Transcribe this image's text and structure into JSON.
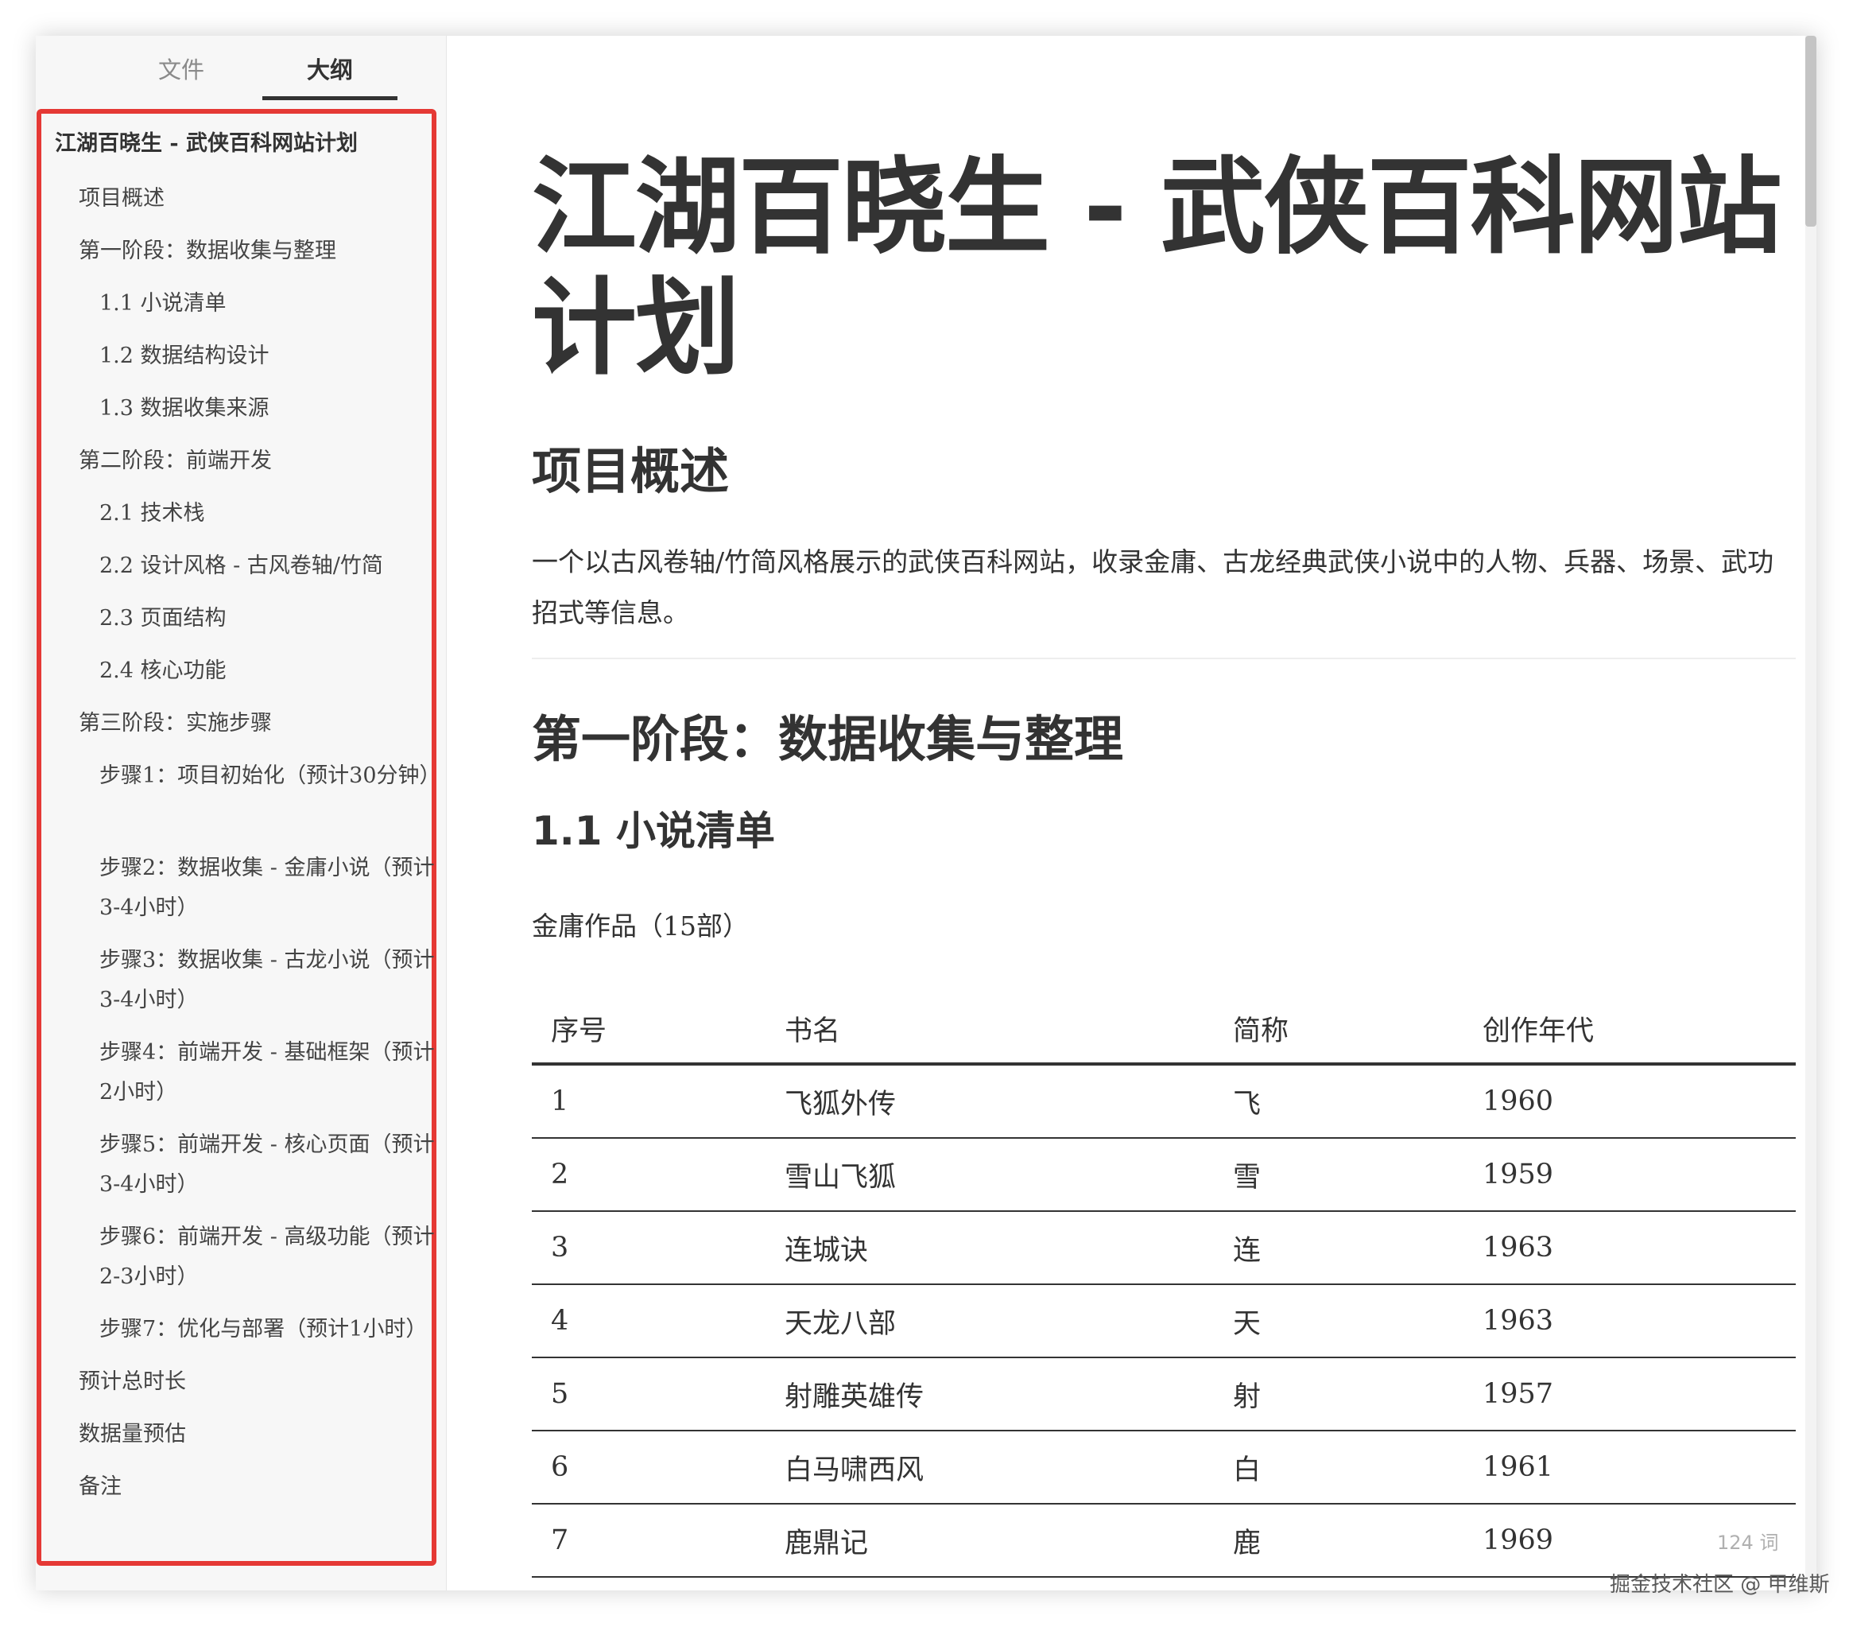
{
  "tabs": {
    "files": "文件",
    "outline": "大纲"
  },
  "outline": [
    {
      "level": "h1",
      "label": "江湖百晓生 - 武侠百科网站计划"
    },
    {
      "level": "h2",
      "label": "项目概述"
    },
    {
      "level": "h2",
      "label": "第一阶段：数据收集与整理"
    },
    {
      "level": "h3",
      "label": "1.1 小说清单"
    },
    {
      "level": "h3",
      "label": "1.2 数据结构设计"
    },
    {
      "level": "h3",
      "label": "1.3 数据收集来源"
    },
    {
      "level": "h2",
      "label": "第二阶段：前端开发"
    },
    {
      "level": "h3",
      "label": "2.1 技术栈"
    },
    {
      "level": "h3",
      "label": "2.2 设计风格 - 古风卷轴/竹简"
    },
    {
      "level": "h3",
      "label": "2.3 页面结构"
    },
    {
      "level": "h3",
      "label": "2.4 核心功能"
    },
    {
      "level": "h2",
      "label": "第三阶段：实施步骤"
    },
    {
      "level": "h3 wrap",
      "label": "步骤1：项目初始化（预计30分钟）"
    },
    {
      "level": "h3 wrap",
      "label": "步骤2：数据收集 - 金庸小说（预计3-4小时）"
    },
    {
      "level": "h3 wrap",
      "label": "步骤3：数据收集 - 古龙小说（预计3-4小时）"
    },
    {
      "level": "h3 wrap",
      "label": "步骤4：前端开发 - 基础框架（预计2小时）"
    },
    {
      "level": "h3 wrap",
      "label": "步骤5：前端开发 - 核心页面（预计3-4小时）"
    },
    {
      "level": "h3 wrap",
      "label": "步骤6：前端开发 - 高级功能（预计2-3小时）"
    },
    {
      "level": "h3",
      "label": "步骤7：优化与部署（预计1小时）"
    },
    {
      "level": "h2",
      "label": "预计总时长"
    },
    {
      "level": "h2",
      "label": "数据量预估"
    },
    {
      "level": "h2",
      "label": "备注"
    }
  ],
  "footer": {
    "back_icon": "‹",
    "code_icon": "</>",
    "word_count": "124 词",
    "watermark": "掘金技术社区 @ 甲维斯"
  },
  "doc": {
    "title": "江湖百晓生 - 武侠百科网站计划",
    "overview_heading": "项目概述",
    "overview_text": "一个以古风卷轴/竹简风格展示的武侠百科网站，收录金庸、古龙经典武侠小说中的人物、兵器、场景、武功招式等信息。",
    "phase1_heading": "第一阶段：数据收集与整理",
    "section_1_1": "1.1 小说清单",
    "jinyong_label": "金庸作品（15部）",
    "table": {
      "headers": [
        "序号",
        "书名",
        "简称",
        "创作年代"
      ],
      "rows": [
        [
          "1",
          "飞狐外传",
          "飞",
          "1960"
        ],
        [
          "2",
          "雪山飞狐",
          "雪",
          "1959"
        ],
        [
          "3",
          "连城诀",
          "连",
          "1963"
        ],
        [
          "4",
          "天龙八部",
          "天",
          "1963"
        ],
        [
          "5",
          "射雕英雄传",
          "射",
          "1957"
        ],
        [
          "6",
          "白马啸西风",
          "白",
          "1961"
        ],
        [
          "7",
          "鹿鼎记",
          "鹿",
          "1969"
        ]
      ]
    }
  },
  "colors": {
    "highlight_border": "#e53935",
    "sidebar_bg": "#f7f7f7",
    "text": "#333333"
  }
}
